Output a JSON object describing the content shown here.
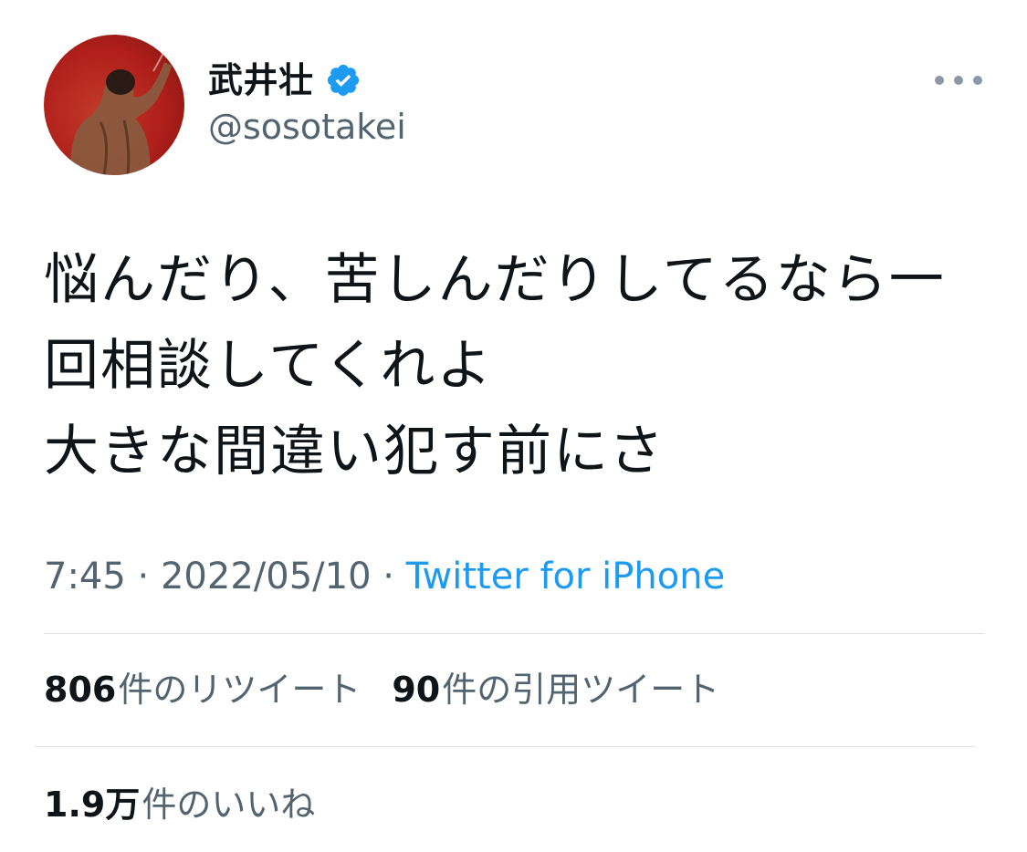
{
  "author": {
    "name": "武井壮",
    "handle": "@sosotakei",
    "verified": true,
    "verified_icon": "verified-badge-icon",
    "avatar_icon": "avatar-photo"
  },
  "tweet": {
    "lines": [
      "悩んだり、苦しんだりしてるなら一",
      "回相談してくれよ",
      "大きな間違い犯す前にさ"
    ]
  },
  "meta": {
    "time": "7:45",
    "separator": "·",
    "date": "2022/05/10",
    "source": "Twitter for iPhone"
  },
  "stats": {
    "retweets": {
      "count": "806",
      "label": "件のリツイート"
    },
    "quotes": {
      "count": "90",
      "label": "件の引用ツイート"
    },
    "likes": {
      "count": "1.9万",
      "label": "件のいいね"
    }
  },
  "colors": {
    "text": "#0f1419",
    "secondary": "#536471",
    "link": "#1d9bf0",
    "divider": "#dfe3e6",
    "verified": "#1d9bf0",
    "avatar_bg": "#b01f1a"
  }
}
